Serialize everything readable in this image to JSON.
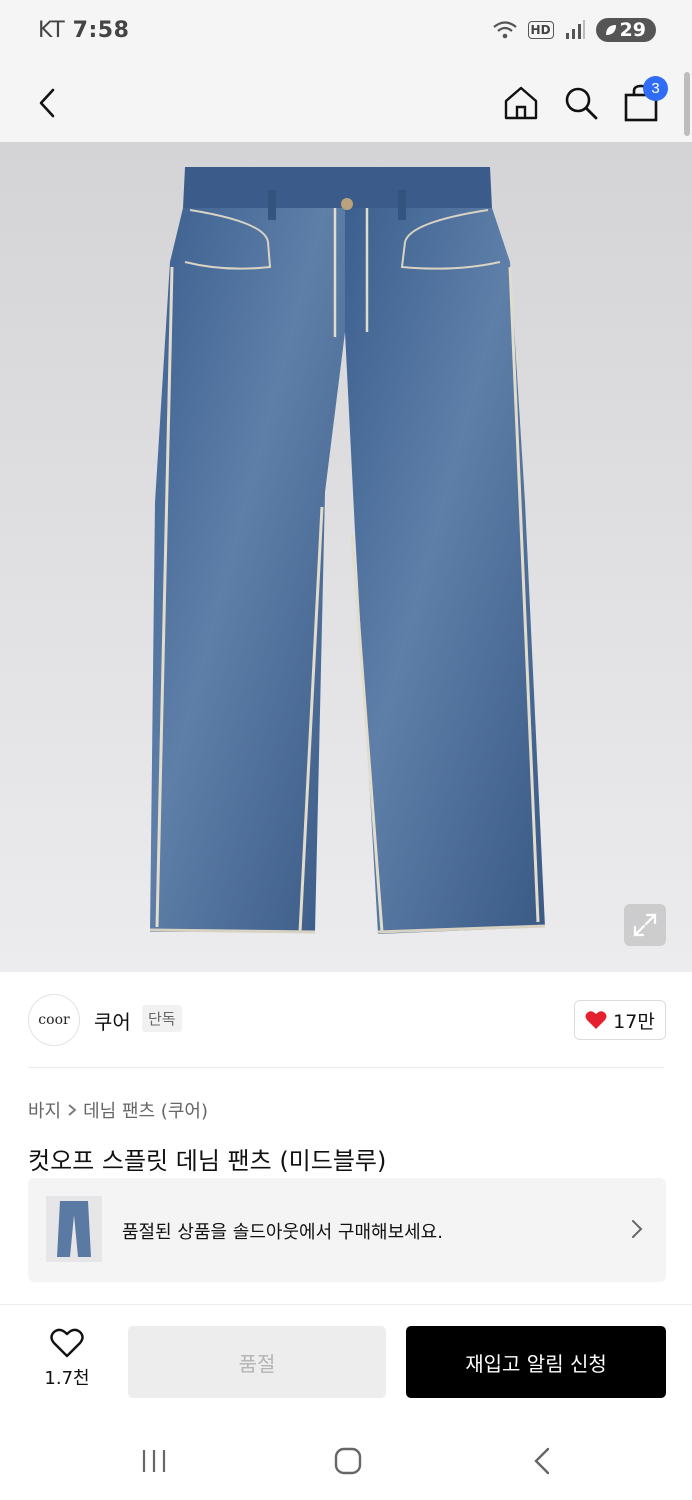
{
  "status_bar": {
    "carrier": "KT",
    "time": "7:58",
    "hd_label": "HD",
    "battery": "29"
  },
  "nav": {
    "cart_count": "3"
  },
  "product": {
    "image_alt": "denim-pants-photo",
    "brand_logo_text": "coor",
    "brand_name": "쿠어",
    "exclusive_label": "단독",
    "brand_likes": "17만",
    "breadcrumb": {
      "category": "바지",
      "subcategory": "데님 팬츠 (쿠어)"
    },
    "title": "컷오프 스플릿 데님 팬츠 (미드블루)"
  },
  "soldout_banner": {
    "text": "품절된 상품을 솔드아웃에서 구매해보세요."
  },
  "action_bar": {
    "wish_count": "1.7천",
    "soldout_label": "품절",
    "restock_label": "재입고 알림 신청"
  },
  "colors": {
    "accent_blue": "#2f6df6",
    "heart_red": "#e5202e",
    "primary_black": "#000000",
    "disabled_gray": "#ededed"
  }
}
